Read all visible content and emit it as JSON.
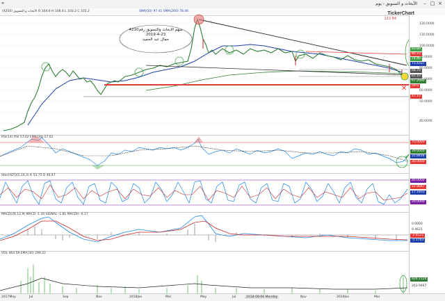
{
  "window": {
    "title": "الأبحاث و التسويق - يوم",
    "symbol_line": "الأبحاث و التسويق (4210)  O 104.6  H 108.4  L 103.2  C 105.2",
    "ma_legend": "SMA(50) 97.41  SMA(200) 78.46",
    "logo": "TickerChart"
  },
  "annotation": {
    "line1": "سهم الابحاث والتسويق رقم4210",
    "line2": "2019-4-23",
    "line3": "جمال عبد الحميد"
  },
  "price_pane": {
    "top_label": "122.84",
    "levels": [
      "120.0000",
      "110.0000",
      "100.0000",
      "90.0000",
      "80.0000",
      "70.0000",
      "60.0000",
      "50.0000",
      "40.0000"
    ],
    "tags": [
      {
        "text": "83.80",
        "color": "#43a047"
      },
      {
        "text": "80.10",
        "color": "#e53935"
      },
      {
        "text": "74.40",
        "color": "#43a047"
      },
      {
        "text": "71.4337",
        "color": "#1e40af"
      },
      {
        "text": "68.70",
        "color": "#555555"
      },
      {
        "text": "65.10",
        "color": "#555555"
      },
      {
        "text": "67.2000",
        "color": "#2e7d32"
      },
      {
        "text": "59.9",
        "color": "#e53935"
      },
      {
        "text": "47.10",
        "color": "#e53935"
      }
    ]
  },
  "rsi_pane": {
    "label": "RSI(14)  RSI 57.02   EMA(30)  57.02",
    "tags": [
      {
        "text": "70.0000",
        "color": "#e53935"
      },
      {
        "text": "39.0000",
        "color": "#2e7d32"
      },
      {
        "text": "31.8416",
        "color": "#1e40af"
      },
      {
        "text": "30.0000",
        "color": "#e53935"
      }
    ]
  },
  "stoch_pane": {
    "label": "StochSTO(5,14,3)  K 53.75  D 40.47",
    "tags": [
      {
        "text": "80.0000",
        "color": "#7b1fa2"
      },
      {
        "text": "22.8667",
        "color": "#e53935"
      },
      {
        "text": "17.1833",
        "color": "#1e40af"
      },
      {
        "text": "20.0000",
        "color": "#7b1fa2"
      }
    ]
  },
  "macd_pane": {
    "label": "MACD(26,12,9)  MACD -1.10  SIGNAL -1.81  MACDH -0.17",
    "tags": [
      {
        "text": "0.0000",
        "color": "#333333"
      },
      {
        "text": "0.4621",
        "color": "#333333"
      },
      {
        "text": "-2.8121",
        "color": "#e53935"
      },
      {
        "text": "-1.1743",
        "color": "#1e40af"
      }
    ]
  },
  "volume_pane": {
    "label": "VOL  464.59   EMA(30)  299.22",
    "tags": [
      {
        "text": "824.1124",
        "color": "#2e7d32"
      },
      {
        "text": "263.9467",
        "color": "#333333"
      }
    ]
  },
  "xaxis": {
    "labels": [
      "2017May",
      "Jul",
      "Sep",
      "Nov",
      "2018Jan",
      "Mar",
      "May",
      "Jul",
      "2018-08-06 Monday",
      "Nov",
      "2019Jan",
      "Mar"
    ]
  },
  "colors": {
    "up_candle": "#2e7d32",
    "down_candle": "#c62828",
    "sma50": "#1e40af",
    "sma200": "#2e7d32",
    "support": "#e53935",
    "trend": "#222222"
  }
}
